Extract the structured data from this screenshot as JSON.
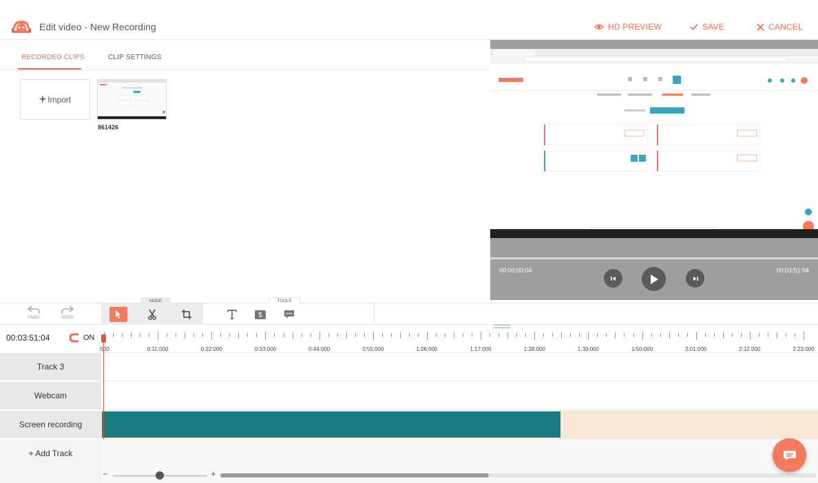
{
  "header": {
    "title": "Edit video - New Recording",
    "hd_preview": "HD PREVIEW",
    "save": "SAVE",
    "cancel": "CANCEL",
    "accent_color": "#f06b4f"
  },
  "clips_panel": {
    "tabs": [
      {
        "label": "RECORDED CLIPS",
        "active": true
      },
      {
        "label": "CLIP SETTINGS",
        "active": false
      }
    ],
    "import_label": "Import",
    "clips": [
      {
        "name": "861426"
      }
    ]
  },
  "preview": {
    "current_time": "00:00:00:04",
    "total_time": "00:03:51:04",
    "controls": [
      "step-back-icon",
      "play-icon",
      "step-forward-icon"
    ]
  },
  "toolbar": {
    "undo_label": "UNDO",
    "redo_label": "REDO",
    "mode_label": "MODE",
    "tools_label": "TOOLS",
    "mode_tools": [
      "select-icon",
      "cut-icon",
      "crop-icon"
    ],
    "tools": [
      "text-icon",
      "sticker-icon",
      "comment-icon"
    ]
  },
  "timeline": {
    "timecode": "00:03:51:04",
    "snap_label": "ON",
    "ruler_labels": [
      ":000",
      "0:11:000",
      "0:22:000",
      "0:33:000",
      "0:44:000",
      "0:55:000",
      "1:06:000",
      "1:17:000",
      "1:28:000",
      "1:39:000",
      "1:50:000",
      "2:01:000",
      "2:12:000",
      "2:23:000"
    ],
    "tracks": [
      {
        "label": "Track 3"
      },
      {
        "label": "Webcam"
      },
      {
        "label": "Screen recording"
      }
    ],
    "add_track_label": "+ Add Track",
    "clip_color": "#167c80",
    "empty_segment_color": "#f7e8d4",
    "screen_recording_fill_fraction": 0.64,
    "scroll_fraction": 0.45,
    "zoom_fraction": 0.45
  }
}
